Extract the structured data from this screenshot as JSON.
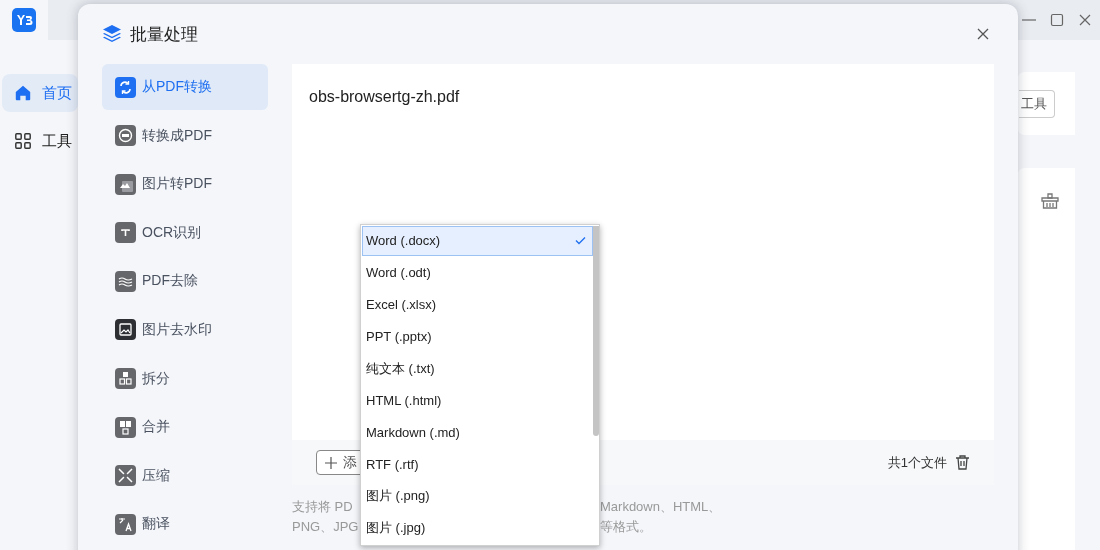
{
  "app": {
    "nav": [
      {
        "label": "首页",
        "selected": true
      },
      {
        "label": "工具",
        "selected": false
      }
    ],
    "tool_button": "工具"
  },
  "dialog": {
    "title": "批量处理",
    "sidebar": [
      {
        "label": "从PDF转换",
        "selected": true
      },
      {
        "label": "转换成PDF",
        "selected": false
      },
      {
        "label": "图片转PDF",
        "selected": false
      },
      {
        "label": "OCR识别",
        "selected": false
      },
      {
        "label": "PDF去除",
        "selected": false
      },
      {
        "label": "图片去水印",
        "selected": false
      },
      {
        "label": "拆分",
        "selected": false
      },
      {
        "label": "合并",
        "selected": false
      },
      {
        "label": "压缩",
        "selected": false
      },
      {
        "label": "翻译",
        "selected": false
      }
    ],
    "file": "obs-browsertg-zh.pdf",
    "add_button": "添",
    "file_count": "共1个文件",
    "description_lines": [
      {
        "left": "支持将 PD",
        "right": "Markdown、HTML、"
      },
      {
        "left": "PNG、JPG",
        "right": "等格式。"
      }
    ]
  },
  "format_menu": {
    "options": [
      {
        "label": "Word (.docx)",
        "selected": true
      },
      {
        "label": "Word (.odt)",
        "selected": false
      },
      {
        "label": "Excel (.xlsx)",
        "selected": false
      },
      {
        "label": "PPT (.pptx)",
        "selected": false
      },
      {
        "label": "纯文本 (.txt)",
        "selected": false
      },
      {
        "label": "HTML (.html)",
        "selected": false
      },
      {
        "label": "Markdown (.md)",
        "selected": false
      },
      {
        "label": "RTF (.rtf)",
        "selected": false
      },
      {
        "label": "图片 (.png)",
        "selected": false
      },
      {
        "label": "图片 (.jpg)",
        "selected": false
      }
    ]
  }
}
